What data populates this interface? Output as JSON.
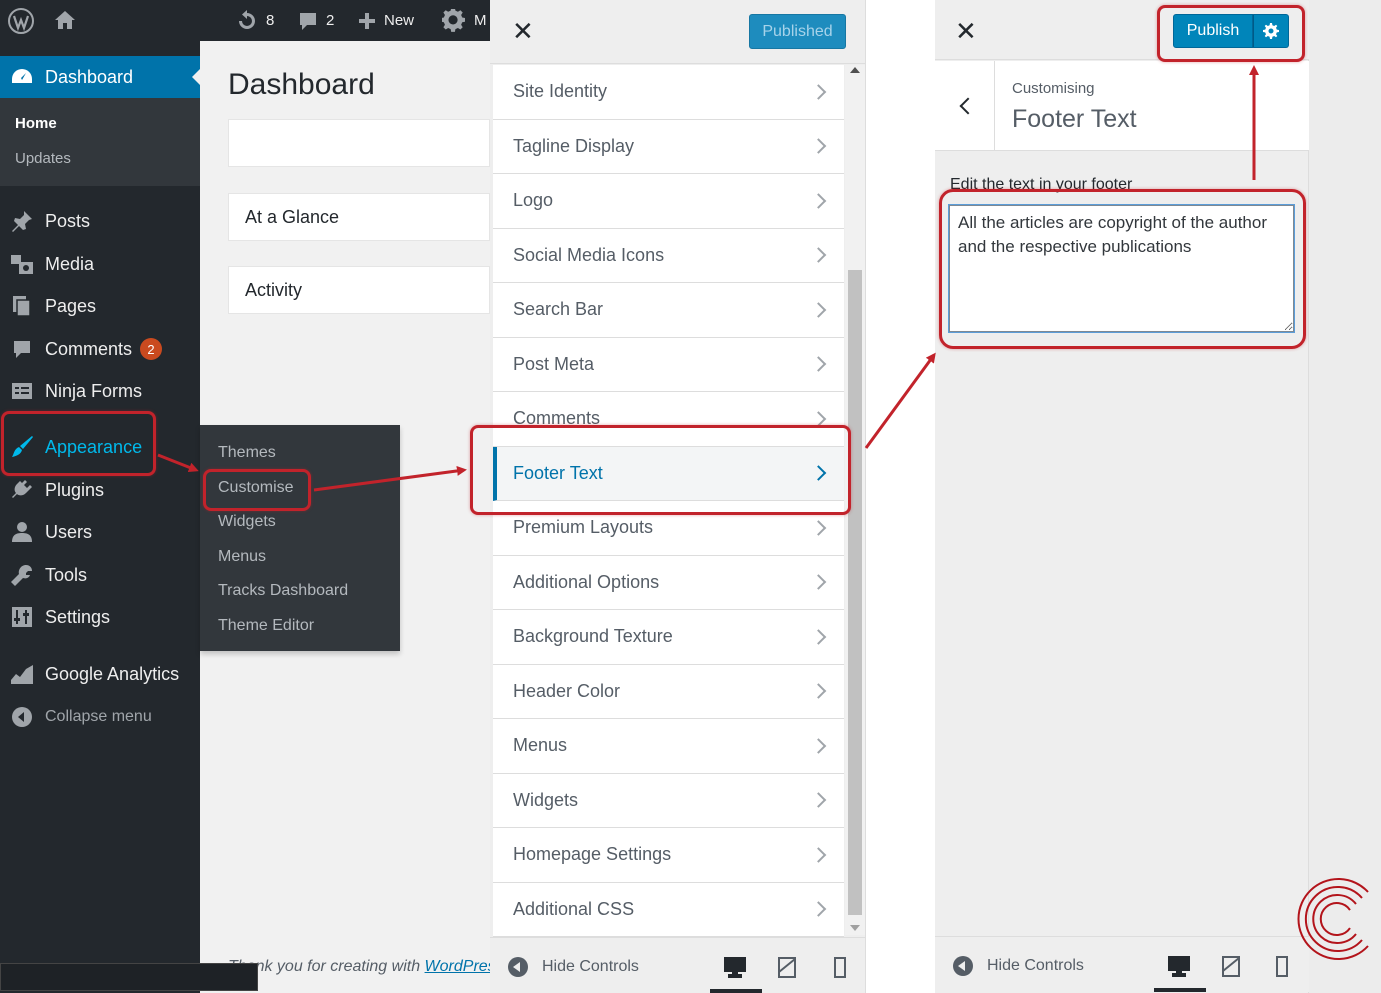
{
  "admin_bar": {
    "updates_count": "8",
    "comments_count": "2",
    "new_label": "New",
    "gear_suffix": "M"
  },
  "admin_menu": {
    "dashboard": "Dashboard",
    "dashboard_sub": {
      "home": "Home",
      "updates": "Updates"
    },
    "posts": "Posts",
    "media": "Media",
    "pages": "Pages",
    "comments": "Comments",
    "comments_badge": "2",
    "ninja_forms": "Ninja Forms",
    "appearance": "Appearance",
    "plugins": "Plugins",
    "users": "Users",
    "tools": "Tools",
    "settings": "Settings",
    "google_analytics": "Google Analytics",
    "collapse": "Collapse menu"
  },
  "appearance_submenu": [
    "Themes",
    "Customise",
    "Widgets",
    "Menus",
    "Tracks Dashboard",
    "Theme Editor"
  ],
  "dashboard": {
    "title": "Dashboard",
    "boxes": [
      "",
      "At a Glance",
      "Activity"
    ],
    "footer_thanks": "Thank you for creating with ",
    "footer_link": "WordPress"
  },
  "customizer": {
    "published_label": "Published",
    "sections": [
      "Site Identity",
      "Tagline Display",
      "Logo",
      "Social Media Icons",
      "Search Bar",
      "Post Meta",
      "Comments",
      "Footer Text",
      "Premium Layouts",
      "Additional Options",
      "Background Texture",
      "Header Color",
      "Menus",
      "Widgets",
      "Homepage Settings",
      "Additional CSS"
    ],
    "active_section": "Footer Text",
    "hide_controls": "Hide Controls"
  },
  "footer_panel": {
    "publish_label": "Publish",
    "customising_label": "Customising",
    "section_title": "Footer Text",
    "control_label": "Edit the text in your footer",
    "textarea_value": "All the articles are copyright of the author and the respective publications",
    "hide_controls": "Hide Controls"
  },
  "colors": {
    "wp_blue": "#0073aa",
    "admin_dark": "#23282d",
    "highlight_red": "#c2232b"
  }
}
